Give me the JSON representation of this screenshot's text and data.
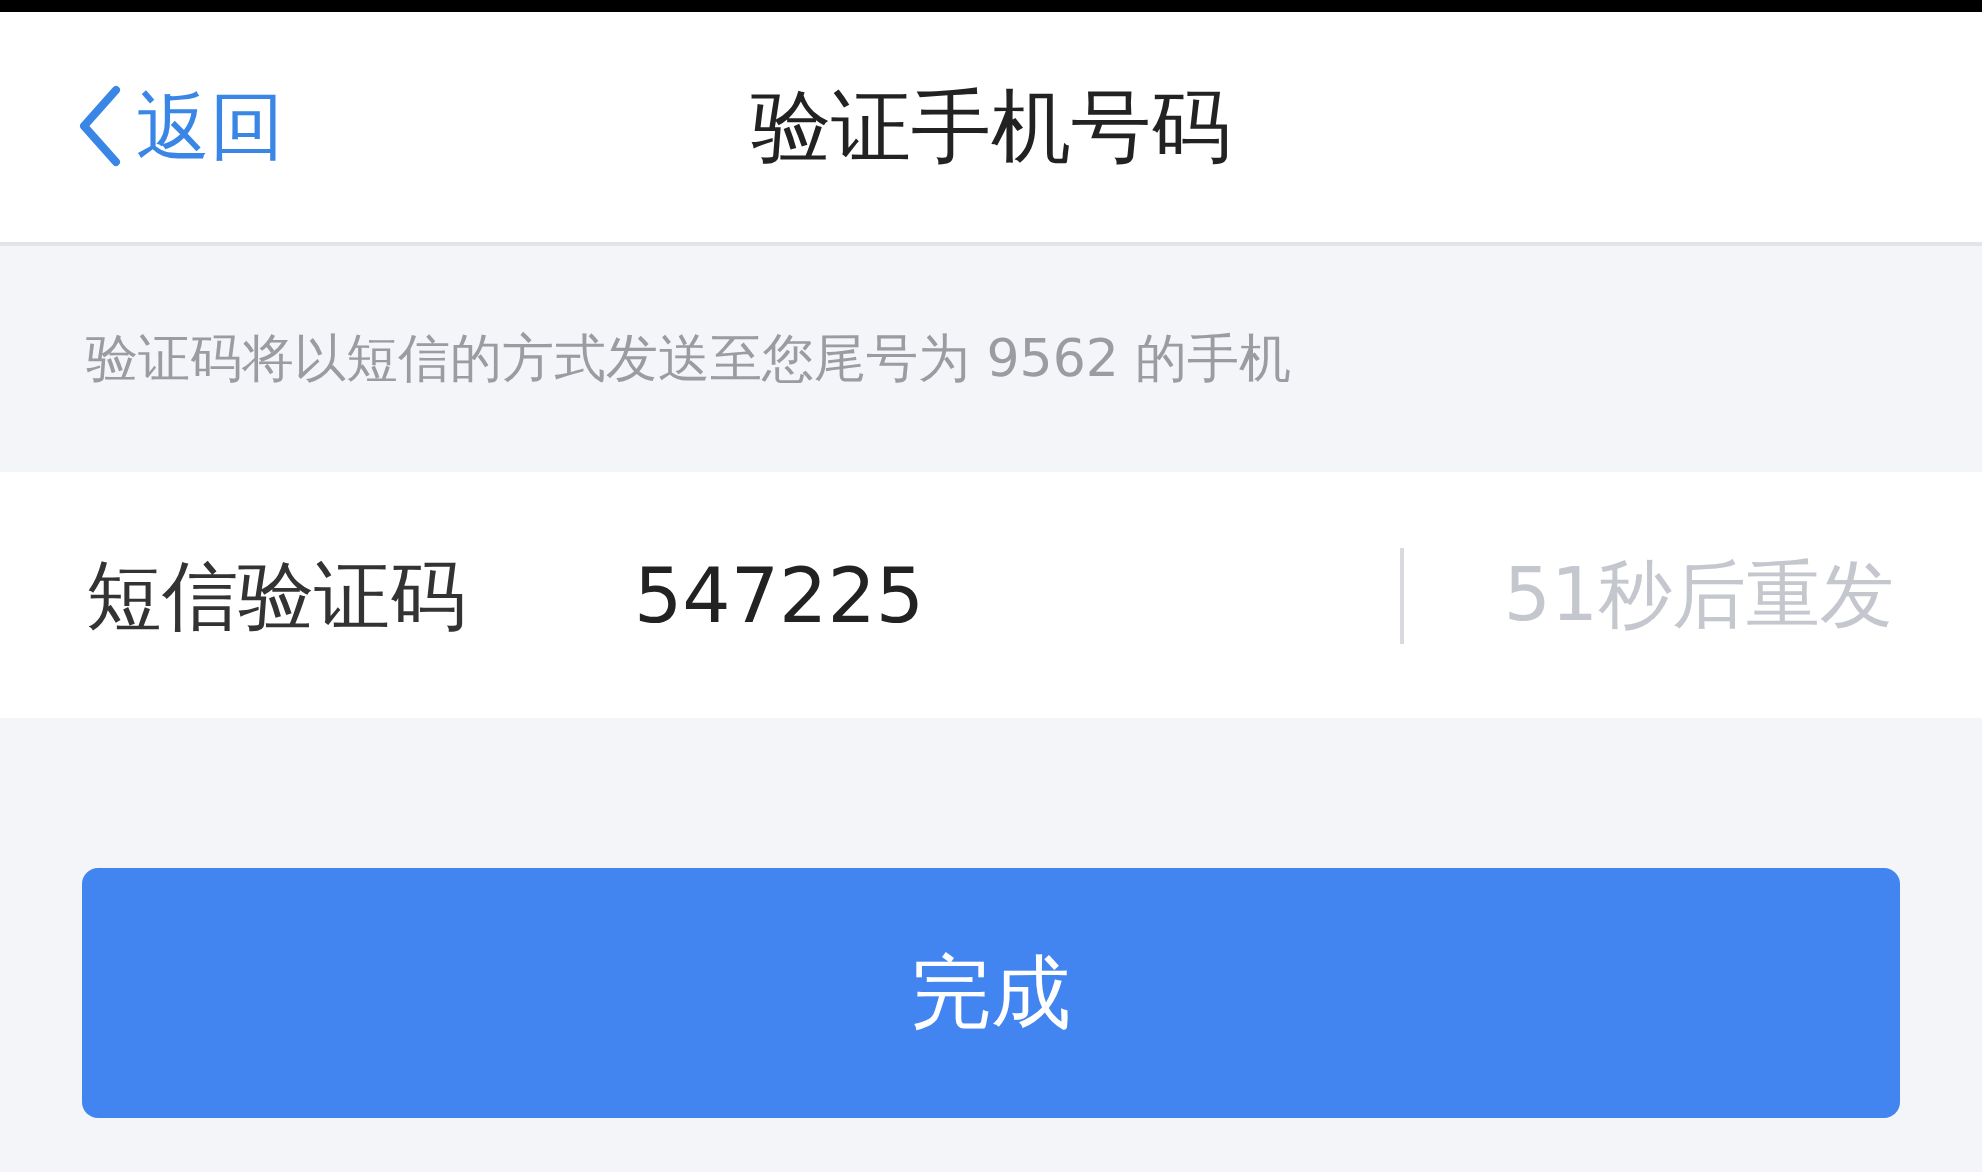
{
  "header": {
    "back_label": "返回",
    "title": "验证手机号码"
  },
  "hint": "验证码将以短信的方式发送至您尾号为 9562 的手机",
  "code_field": {
    "label": "短信验证码",
    "value": "547225"
  },
  "resend": {
    "label": "51秒后重发",
    "disabled": true
  },
  "submit_button": {
    "label": "完成"
  }
}
